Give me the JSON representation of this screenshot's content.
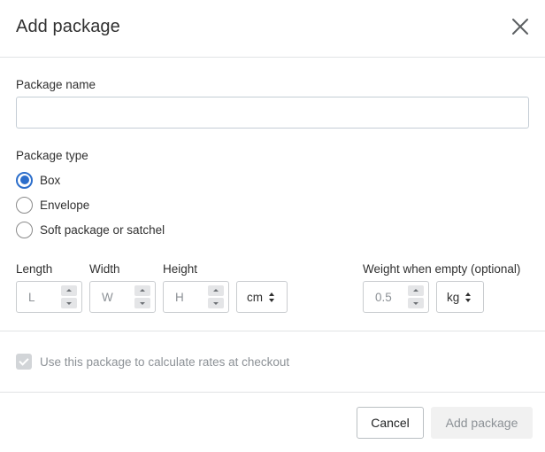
{
  "dialog": {
    "title": "Add package",
    "close_icon": "close-x-icon"
  },
  "package_name": {
    "label": "Package name",
    "value": "",
    "placeholder": ""
  },
  "package_type": {
    "label": "Package type",
    "selected": "Box",
    "options": [
      {
        "label": "Box",
        "checked": true
      },
      {
        "label": "Envelope",
        "checked": false
      },
      {
        "label": "Soft package or satchel",
        "checked": false
      }
    ]
  },
  "dimensions": {
    "length": {
      "label": "Length",
      "placeholder": "L",
      "value": ""
    },
    "width": {
      "label": "Width",
      "placeholder": "W",
      "value": ""
    },
    "height": {
      "label": "Height",
      "placeholder": "H",
      "value": ""
    },
    "unit": {
      "selected": "cm"
    }
  },
  "weight": {
    "label": "Weight when empty (optional)",
    "placeholder": "0.5",
    "value": "",
    "unit": {
      "selected": "kg"
    }
  },
  "checkout_option": {
    "label": "Use this package to calculate rates at checkout",
    "checked": true,
    "disabled": true
  },
  "footer": {
    "cancel_label": "Cancel",
    "add_label": "Add package"
  },
  "colors": {
    "accent": "#2c6ecb",
    "disabled_text": "#8c9196",
    "disabled_bg": "#f1f1f1"
  }
}
